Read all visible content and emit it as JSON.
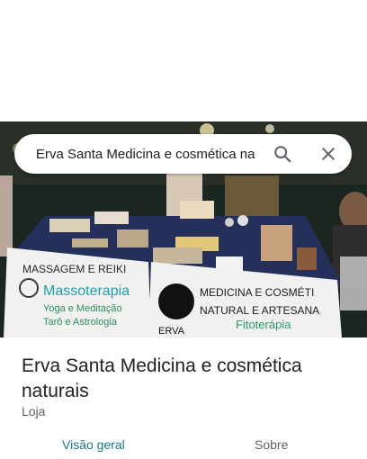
{
  "search": {
    "query": "Erva Santa Medicina e cosmética na"
  },
  "photo": {
    "banner_left_line1": "MASSAGEM E REIKI",
    "banner_left_line2": "Massoterapia",
    "banner_left_line3": "Yoga e Meditação",
    "banner_left_line4": "Tarô e Astrologia",
    "banner_right_line1": "MEDICINA E COSMÉTI",
    "banner_right_line2": "NATURAL E ARTESANA",
    "banner_right_line3": "Fitoterápia",
    "banner_right_brand": "ERVA"
  },
  "place": {
    "name": "Erva Santa Medicina e cosmética naturais",
    "category": "Loja"
  },
  "tabs": [
    {
      "label": "Visão geral",
      "active": true
    },
    {
      "label": "Sobre",
      "active": false
    }
  ],
  "colors": {
    "accent": "#1a7a84",
    "title": "#202124",
    "secondary": "#5f6368"
  }
}
